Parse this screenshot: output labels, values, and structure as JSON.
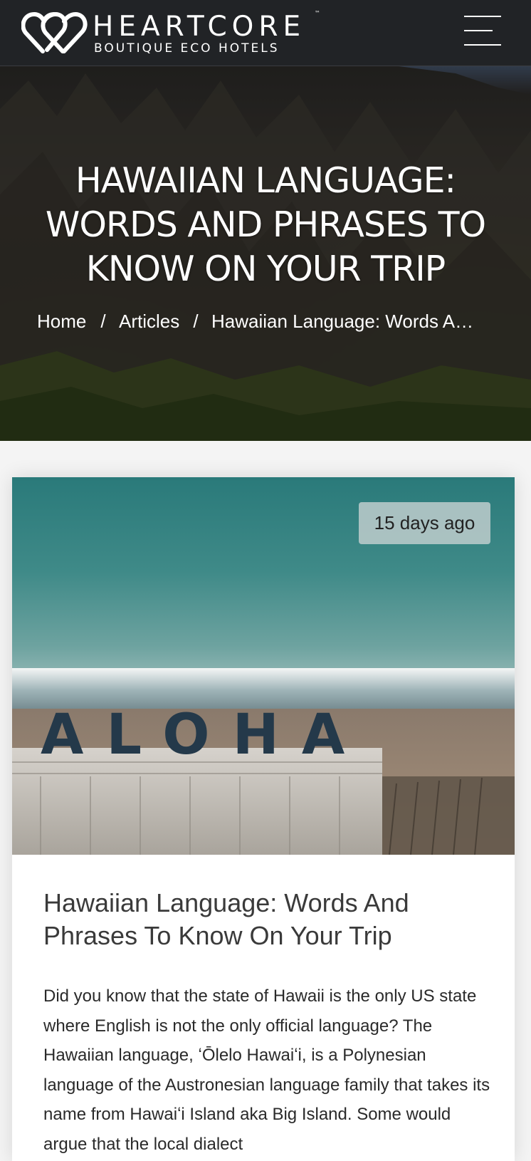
{
  "header": {
    "brand_name": "HEARTCORE",
    "trademark": "™",
    "brand_tagline": "BOUTIQUE ECO HOTELS",
    "menu_icon": "hamburger-icon",
    "logo_icon": "double-heart-icon",
    "background_color": "#212326"
  },
  "hero": {
    "title": "HAWAIIAN LANGUAGE: WORDS AND PHRASES TO KNOW ON YOUR TRIP",
    "breadcrumb": {
      "home": "Home",
      "articles": "Articles",
      "current": "Hawaiian Language: Words And Phrases To Know On Your Trip",
      "separator": "/"
    }
  },
  "article": {
    "date": "15 days ago",
    "image_sign_text": "ALOHA",
    "title": "Hawaiian Language: Words And Phrases To Know On Your Trip",
    "body": "Did you know that the state of Hawaii is the only US state where English is not the only official language? The Hawaiian language, ʻŌlelo Hawaiʻi, is a Polynesian language of the Austronesian language family that takes its name from Hawaiʻi Island aka Big Island. Some would argue that the local dialect"
  }
}
